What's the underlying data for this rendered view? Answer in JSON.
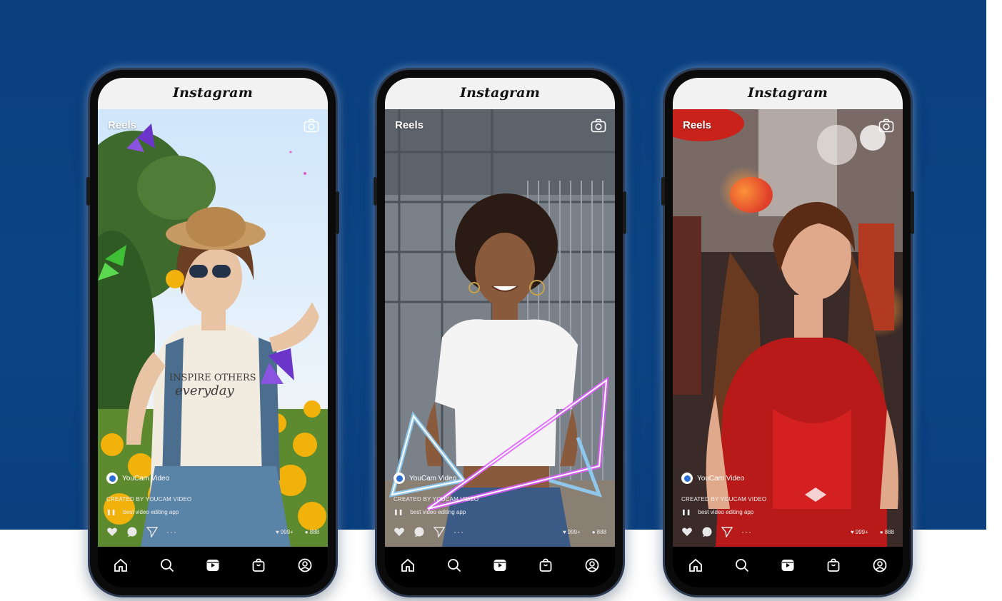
{
  "colors": {
    "background_band": "#0b4485",
    "accent": "#2a6fd6"
  },
  "phones": [
    {
      "header_logo": "Instagram",
      "reels_label": "Reels",
      "creator_name": "YouCam Video",
      "credit": "CREATED BY YOUCAM VIDEO",
      "pause": "❚❚",
      "description": "best video editing app",
      "likes": "999+",
      "comments": "888",
      "more": "···"
    },
    {
      "header_logo": "Instagram",
      "reels_label": "Reels",
      "creator_name": "YouCam Video",
      "credit": "CREATED BY YOUCAM VIDEO",
      "pause": "❚❚",
      "description": "best video editing app",
      "likes": "999+",
      "comments": "888",
      "more": "···"
    },
    {
      "header_logo": "Instagram",
      "reels_label": "Reels",
      "creator_name": "YouCam Video",
      "credit": "CREATED BY YOUCAM VIDEO",
      "pause": "❚❚",
      "description": "best video editing app",
      "likes": "999+",
      "comments": "888",
      "more": "···"
    }
  ],
  "bottom_nav_icons": [
    "home-icon",
    "search-icon",
    "reels-icon",
    "shop-icon",
    "profile-icon"
  ]
}
